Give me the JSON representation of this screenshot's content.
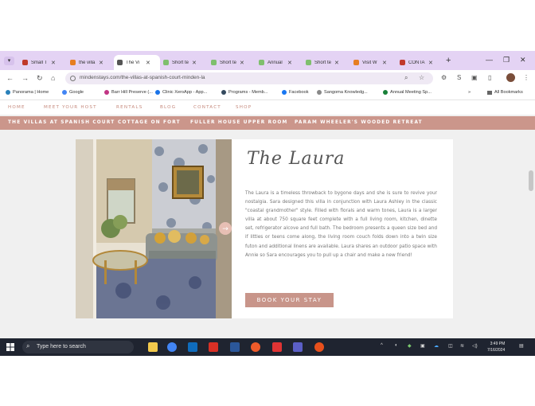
{
  "browser": {
    "tabs": [
      {
        "title": "Small T",
        "color": "#c0392b",
        "active": false
      },
      {
        "title": "the villa",
        "color": "#e67e22",
        "active": false
      },
      {
        "title": "The Vi",
        "color": "#555555",
        "active": true
      },
      {
        "title": "Short te",
        "color": "#7fbf6e",
        "active": false
      },
      {
        "title": "Short te",
        "color": "#7fbf6e",
        "active": false
      },
      {
        "title": "Annual",
        "color": "#7fbf6e",
        "active": false
      },
      {
        "title": "Short te",
        "color": "#7fbf6e",
        "active": false
      },
      {
        "title": "Visit W",
        "color": "#e67e22",
        "active": false
      },
      {
        "title": "CONTA",
        "color": "#c0392b",
        "active": false
      }
    ],
    "close_glyph": "✕",
    "new_tab_glyph": "+",
    "url": "mindenstays.com/the-villas-at-spanish-court-minden-la",
    "bookmarks": [
      {
        "label": "Panorama | Home",
        "color": "#2980b9"
      },
      {
        "label": "Google",
        "color": "#4285f4"
      },
      {
        "label": "Barr Hill Preserve (...",
        "color": "#c13584"
      },
      {
        "label": "Clinic XeroApp - App...",
        "color": "#1a73e8"
      },
      {
        "label": "Programs - Memb...",
        "color": "#34495e"
      },
      {
        "label": "Facebook",
        "color": "#1877f2"
      },
      {
        "label": "Sangoma Knowledg...",
        "color": "#888888"
      },
      {
        "label": "Annual Meeting Sp...",
        "color": "#188038"
      }
    ],
    "all_bookmarks": "All Bookmarks"
  },
  "site": {
    "nav": [
      "HOME",
      "MEET YOUR HOST",
      "RENTALS",
      "BLOG",
      "CONTACT",
      "SHOP"
    ],
    "villas": [
      "THE VILLAS AT SPANISH COURT",
      "COTTAGE ON FORT",
      "FULLER HOUSE UPPER ROOM",
      "PARAM WHEELER'S WOODED RETREAT"
    ],
    "title": "The Laura",
    "description": "The Laura is a timeless throwback to bygone days and she is sure to revive your nostalgia. Sara designed this villa in conjunction with Laura Ashley in the classic \"coastal grandmother\" style. Filled with florals and warm tones, Laura is a larger villa at about 750 square feet complete with a full living room, kitchen, dinette set, refrigerator alcove and full bath. The bedroom presents a queen size bed and if littles or teens come along, the living room couch folds down into a twin size futon and additional linens are available. Laura shares an outdoor patio space with Annie so Sara encourages you to pull up a chair and make a new friend!",
    "book_label": "BOOK YOUR STAY",
    "accent_color": "#cb968b"
  },
  "taskbar": {
    "search_placeholder": "Type here to search",
    "time": "3:49 PM",
    "date": "7/16/2024"
  }
}
